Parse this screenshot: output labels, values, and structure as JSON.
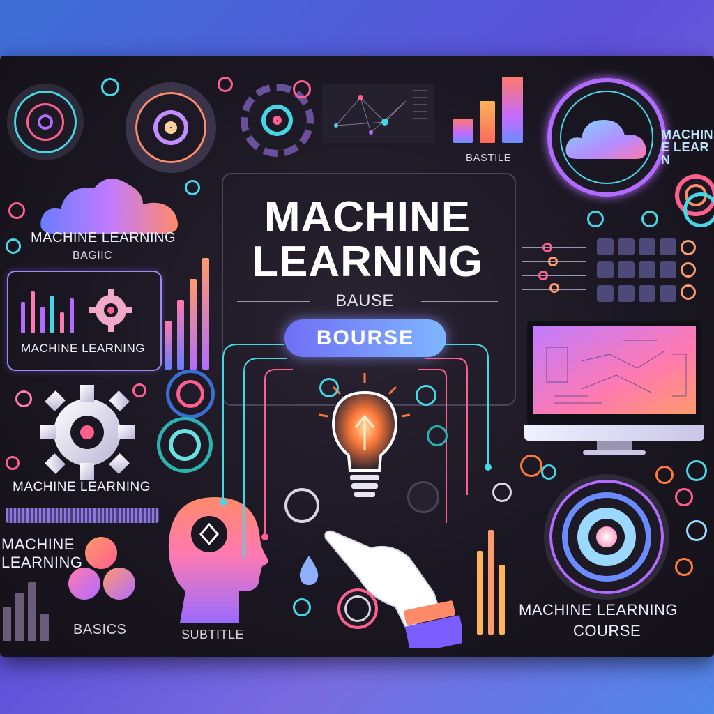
{
  "headline": {
    "line1": "MACHINE",
    "line2": "LEARNING",
    "subtitle": "BAUSE"
  },
  "pill_label": "BOURSE",
  "labels": {
    "top_right_logo": "MACHINE LEARN",
    "chart_caption": "BASTILE",
    "cloud_caption": "MACHINE LEARNING",
    "cloud_sub": "BAGIIC",
    "panel_caption": "MACHINE LEARNING",
    "gear_caption": "MACHINE LEARNING",
    "left_mid_title_1": "MACHINE",
    "left_mid_title_2": "LEARNING",
    "basics": "BASICS",
    "subtitle_bottom": "SUBTITLE",
    "course_1": "MACHINE LEARNING",
    "course_2": "COURSE"
  },
  "colors": {
    "accent_pink": "#ff5f8f",
    "accent_purple": "#b36bff",
    "accent_blue": "#5a9bff",
    "accent_cyan": "#46d6e6",
    "background_dark": "#1b1722"
  },
  "icons": [
    "cloud-icon",
    "gear-icon",
    "light-bulb-icon",
    "head-profile-icon",
    "hand-icon",
    "monitor-icon",
    "target-ring-icon",
    "bar-chart-icon",
    "water-drop-icon"
  ]
}
